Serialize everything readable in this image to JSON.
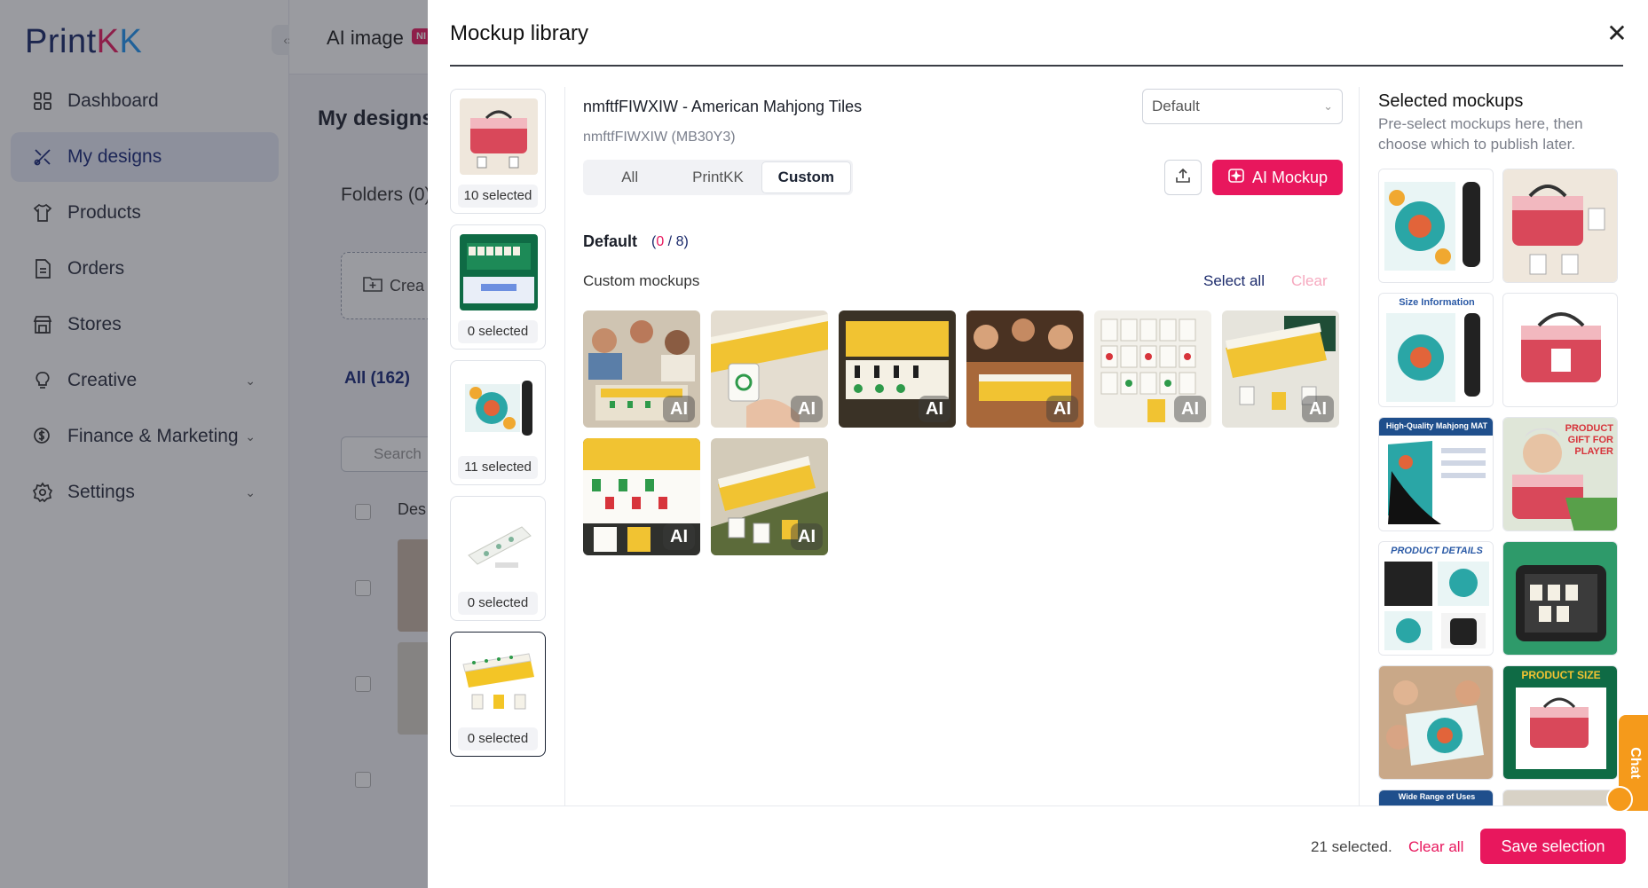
{
  "app": {
    "logo": "PrintKK",
    "topbar": {
      "ai_image": "AI image",
      "new_badge": "NI"
    },
    "nav": [
      {
        "label": "Dashboard",
        "icon": "grid-icon"
      },
      {
        "label": "My designs",
        "icon": "design-icon",
        "active": true
      },
      {
        "label": "Products",
        "icon": "shirt-icon"
      },
      {
        "label": "Orders",
        "icon": "document-icon"
      },
      {
        "label": "Stores",
        "icon": "store-icon"
      },
      {
        "label": "Creative",
        "icon": "bulb-icon",
        "has_children": true
      },
      {
        "label": "Finance & Marketing",
        "icon": "dollar-icon",
        "has_children": true
      },
      {
        "label": "Settings",
        "icon": "gear-icon",
        "has_children": true
      }
    ],
    "content": {
      "title": "My designs",
      "folders": "Folders (0)",
      "create": "Crea",
      "all_tab": "All (162)",
      "search_placeholder": "Search",
      "table_header": "Des"
    }
  },
  "modal": {
    "title": "Mockup library",
    "design_list": [
      {
        "count": "10 selected",
        "active": false
      },
      {
        "count": "0 selected",
        "active": false
      },
      {
        "count": "11 selected",
        "active": false
      },
      {
        "count": "0 selected",
        "active": false
      },
      {
        "count": "0 selected",
        "active": true
      }
    ],
    "design": {
      "name": "nmftfFIWXIW - American Mahjong Tiles",
      "sku": "nmftfFIWXIW (MB30Y3)"
    },
    "template_select": {
      "value": "Default"
    },
    "tabs": [
      {
        "label": "All",
        "active": false
      },
      {
        "label": "PrintKK",
        "active": false
      },
      {
        "label": "Custom",
        "active": true
      }
    ],
    "ai_mockup_label": "AI Mockup",
    "section": {
      "title": "Default",
      "count_open": "(",
      "count_now": "0",
      "count_rest": " / 8)",
      "sub_label": "Custom mockups",
      "select_all": "Select all",
      "clear": "Clear"
    },
    "mockups": [
      {
        "name": "people-playing-table",
        "ai": "AI"
      },
      {
        "name": "hand-holding-tile",
        "ai": "AI"
      },
      {
        "name": "tile-rack-dark",
        "ai": "AI"
      },
      {
        "name": "friends-playing-night",
        "ai": "AI"
      },
      {
        "name": "tile-rows-flat",
        "ai": "AI"
      },
      {
        "name": "green-box-tiles",
        "ai": "AI"
      },
      {
        "name": "tile-rack-closeup",
        "ai": "AI"
      },
      {
        "name": "tiles-on-green-cloth",
        "ai": "AI"
      }
    ],
    "selected": {
      "title": "Selected mockups",
      "description": "Pre-select mockups here, then choose which to publish later.",
      "items": [
        {
          "label": ""
        },
        {
          "label": ""
        },
        {
          "label": "Size Information"
        },
        {
          "label": ""
        },
        {
          "label": "High-Quality Mahjong MAT"
        },
        {
          "label": "PRODUCT GIFT FOR PLAYER"
        },
        {
          "label": "PRODUCT DETAILS"
        },
        {
          "label": ""
        },
        {
          "label": ""
        },
        {
          "label": "PRODUCT SIZE"
        },
        {
          "label": "Wide Range of Uses"
        },
        {
          "label": ""
        }
      ]
    },
    "footer": {
      "count": "21 selected.",
      "clear_all": "Clear all",
      "save": "Save selection"
    },
    "chat": "Chat"
  },
  "colors": {
    "accent": "#e8175d",
    "brand_navy": "#1b2a6b",
    "chat_orange": "#f59a1b"
  }
}
